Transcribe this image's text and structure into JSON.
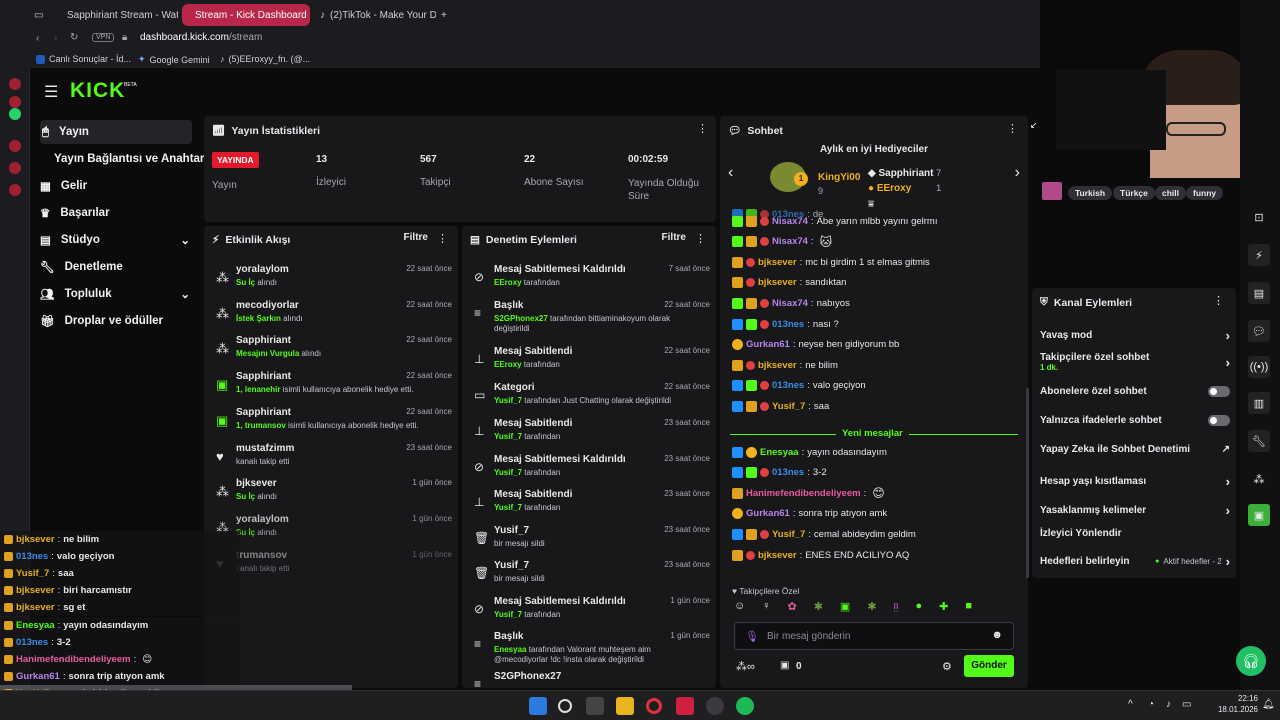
{
  "browser": {
    "tabs": [
      {
        "label": "Sapphiriant Stream - Wat..."
      },
      {
        "label": "Stream - Kick Dashboard"
      },
      {
        "label": "(2)TikTok - Make Your Day"
      }
    ],
    "vpn": "VPN",
    "address_host": "dashboard.kick.com",
    "address_path": "/stream",
    "bookmarks": [
      "Canlı Sonuçlar - İd...",
      "Google Gemini",
      "(5)EEroxyy_fn. (@..."
    ]
  },
  "sidebar": {
    "logo": "KICK",
    "logo_badge": "BETA",
    "items": [
      {
        "label": "Yayın"
      },
      {
        "label": "Yayın Bağlantısı ve Anahtarı"
      },
      {
        "label": "Gelir"
      },
      {
        "label": "Başarılar"
      },
      {
        "label": "Stüdyo"
      },
      {
        "label": "Denetleme"
      },
      {
        "label": "Topluluk"
      },
      {
        "label": "Droplar ve ödüller"
      }
    ]
  },
  "stats": {
    "title": "Yayın İstatistikleri",
    "live_badge": "YAYINDA",
    "live_label": "Yayın",
    "items": [
      {
        "value": "13",
        "label": "İzleyici"
      },
      {
        "value": "567",
        "label": "Takipçi"
      },
      {
        "value": "22",
        "label": "Abone Sayısı"
      },
      {
        "value": "00:02:59",
        "label": "Yayında Olduğu Süre"
      }
    ]
  },
  "activity": {
    "title": "Etkinlik Akışı",
    "filter": "Filtre",
    "events": [
      {
        "user": "yoralaylom",
        "detail_hl": "Su İç",
        "detail": " alındı",
        "time": "22 saat önce"
      },
      {
        "user": "mecodiyorlar",
        "detail_hl": "İstek Şarkın",
        "detail": " alındı",
        "time": "22 saat önce"
      },
      {
        "user": "Sapphiriant",
        "detail_hl": "Mesajını Vurgula",
        "detail": " alındı",
        "time": "22 saat önce"
      },
      {
        "user": "Sapphiriant",
        "detail_hl": "1, lenanehir",
        "detail": " isimli kullanıcıya abonelik hediye etti.",
        "time": "22 saat önce"
      },
      {
        "user": "Sapphiriant",
        "detail_hl": "1, trumansov",
        "detail": " isimli kullanıcıya abonelik hediye etti.",
        "time": "22 saat önce"
      },
      {
        "user": "mustafzimm",
        "detail_hl": "",
        "detail": "kanalı takip etti",
        "time": "23 saat önce"
      },
      {
        "user": "bjksever",
        "detail_hl": "Su İç",
        "detail": " alındı",
        "time": "1 gün önce"
      },
      {
        "user": "yoralaylom",
        "detail_hl": "Su İç",
        "detail": " alındı",
        "time": "1 gün önce"
      },
      {
        "user": "trumansov",
        "detail_hl": "",
        "detail": "kanalı takip etti",
        "time": "1 gün önce"
      }
    ]
  },
  "moderation": {
    "title": "Denetim Eylemleri",
    "filter": "Filtre",
    "actions": [
      {
        "title": "Mesaj Sabitlemesi Kaldırıldı",
        "hl": "EEroxy",
        "rest": " tarafından",
        "time": "7 saat önce"
      },
      {
        "title": "Başlık",
        "hl": "S2GPhonex27",
        "rest": " tarafından bittiaminakoyum olarak değiştirildi",
        "time": "22 saat önce"
      },
      {
        "title": "Mesaj Sabitlendi",
        "hl": "EEroxy",
        "rest": " tarafından",
        "time": "22 saat önce"
      },
      {
        "title": "Kategori",
        "hl": "Yusif_7",
        "rest": " tarafından Just Chatting olarak değiştirildi",
        "time": "22 saat önce"
      },
      {
        "title": "Mesaj Sabitlendi",
        "hl": "Yusif_7",
        "rest": " tarafından",
        "time": "23 saat önce"
      },
      {
        "title": "Mesaj Sabitlemesi Kaldırıldı",
        "hl": "Yusif_7",
        "rest": " tarafından",
        "time": "23 saat önce"
      },
      {
        "title": "Mesaj Sabitlendi",
        "hl": "Yusif_7",
        "rest": " tarafından",
        "time": "23 saat önce"
      },
      {
        "title": "Yusif_7",
        "hl": "",
        "rest": "bir mesajı sildi",
        "time": "23 saat önce"
      },
      {
        "title": "Yusif_7",
        "hl": "",
        "rest": "bir mesajı sildi",
        "time": "23 saat önce"
      },
      {
        "title": "Mesaj Sabitlemesi Kaldırıldı",
        "hl": "Yusif_7",
        "rest": " tarafından",
        "time": "1 gün önce"
      },
      {
        "title": "Başlık",
        "hl": "Enesyaa",
        "rest": " tarafından Valorant muhteşem aim @mecodiyorlar !dc !insta olarak değiştirildi",
        "time": "1 gün önce"
      },
      {
        "title": "S2GPhonex27",
        "hl": "",
        "rest": "",
        "time": ""
      }
    ]
  },
  "chat": {
    "title": "Sohbet",
    "gifters_title": "Aylık en iyi Hediyeciler",
    "gifters": [
      {
        "name": "KingYi00",
        "count": "9"
      },
      {
        "name": "Sapphiriant",
        "count": "7"
      },
      {
        "name": "EEroxy",
        "count": "1"
      }
    ],
    "messages": [
      {
        "user": "013nes",
        "color": "#3a8ee6",
        "text": "de"
      },
      {
        "user": "Nisax74",
        "color": "#b784e8",
        "text": "Abe yarın mlbb yayını gelrmı"
      },
      {
        "user": "Nisax74",
        "color": "#b784e8",
        "text": ""
      },
      {
        "user": "bjksever",
        "color": "#e7b020",
        "text": "mc bi girdim 1 st elmas gitmis"
      },
      {
        "user": "bjksever",
        "color": "#e7b020",
        "text": "sandıktan"
      },
      {
        "user": "Nisax74",
        "color": "#b784e8",
        "text": "nabıyos"
      },
      {
        "user": "013nes",
        "color": "#3a8ee6",
        "text": "nası ?"
      },
      {
        "user": "Gurkan61",
        "color": "#b784e8",
        "text": "neyse ben gidiyorum bb"
      },
      {
        "user": "bjksever",
        "color": "#e7b020",
        "text": "ne bilim"
      },
      {
        "user": "013nes",
        "color": "#3a8ee6",
        "text": "valo geçiyon"
      },
      {
        "user": "Yusif_7",
        "color": "#e7b020",
        "text": "saa"
      }
    ],
    "new_messages": "Yeni mesajlar",
    "messages_new": [
      {
        "user": "Enesyaa",
        "color": "#53fc18",
        "text": "yayın odasındayım"
      },
      {
        "user": "013nes",
        "color": "#3a8ee6",
        "text": "3-2"
      },
      {
        "user": "Hanimefendibendeliyeem",
        "color": "#e85aa0",
        "text": ""
      },
      {
        "user": "Gurkan61",
        "color": "#b784e8",
        "text": "sonra trip atıyon amk"
      },
      {
        "user": "Yusif_7",
        "color": "#e7b020",
        "text": "cemal abideydim geldim"
      },
      {
        "user": "bjksever",
        "color": "#e7b020",
        "text": "ENES END ACILIYO AQ"
      }
    ],
    "followers_only": "Takipçilere Özel",
    "input_placeholder": "Bir mesaj gönderin",
    "points": "0",
    "send": "Gönder"
  },
  "channel_actions": {
    "title": "Kanal Eylemleri",
    "items": [
      {
        "label": "Yavaş mod",
        "sub": "",
        "extra": ""
      },
      {
        "label": "Takipçilere özel sohbet",
        "sub": "1 dk.",
        "extra": ""
      },
      {
        "label": "Abonelere özel sohbet",
        "sub": "",
        "extra": ""
      },
      {
        "label": "Yalnızca ifadelerle sohbet",
        "sub": "",
        "extra": ""
      },
      {
        "label": "Yapay Zeka ile Sohbet Denetimi",
        "sub": "",
        "extra": ""
      },
      {
        "label": "Hesap yaşı kısıtlaması",
        "sub": "",
        "extra": ""
      },
      {
        "label": "Yasaklanmış kelimeler",
        "sub": "",
        "extra": ""
      },
      {
        "label": "İzleyici Yönlendir",
        "sub": "",
        "extra": ""
      },
      {
        "label": "Hedefleri belirleyin",
        "sub": "",
        "extra": "Aktif hedefler - 2"
      }
    ]
  },
  "tags": [
    "Turkish",
    "Türkçe",
    "chill",
    "funny"
  ],
  "overlay_chat": [
    {
      "user": "bjksever",
      "color": "#e7b020",
      "text": "ne bilim"
    },
    {
      "user": "013nes",
      "color": "#3a8ee6",
      "text": "valo geçiyon"
    },
    {
      "user": "Yusif_7",
      "color": "#e7b020",
      "text": "saa"
    },
    {
      "user": "bjksever",
      "color": "#e7b020",
      "text": "biri harcamıstır"
    },
    {
      "user": "bjksever",
      "color": "#e7b020",
      "text": "sg et"
    },
    {
      "user": "Enesyaa",
      "color": "#53fc18",
      "text": "yayın odasındayım"
    },
    {
      "user": "013nes",
      "color": "#3a8ee6",
      "text": "3-2"
    },
    {
      "user": "Hanimefendibendeliyeem",
      "color": "#e85aa0",
      "text": ""
    },
    {
      "user": "Gurkan61",
      "color": "#b784e8",
      "text": "sonra trip atıyon amk"
    },
    {
      "user": "Yusif_7",
      "color": "#e7b020",
      "text": "cemal abideydim geldim"
    },
    {
      "user": "bjksever",
      "color": "#e7b020",
      "text": "ENES END ACILIYO AQ"
    }
  ],
  "taskbar": {
    "time": "22:16",
    "date": "18.01.2026"
  },
  "colors": {
    "kick_green": "#53fc18",
    "panel": "#18181b",
    "live_red": "#e3192c"
  }
}
